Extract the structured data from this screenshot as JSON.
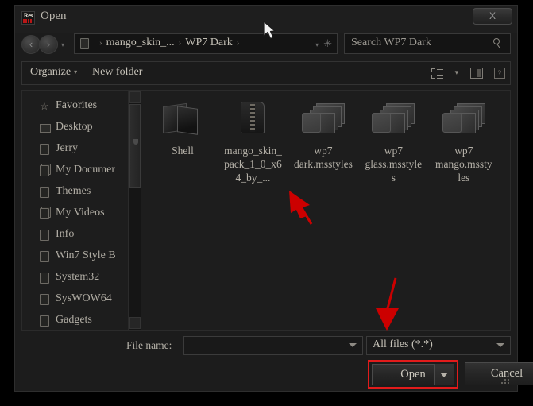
{
  "window": {
    "title": "Open",
    "app_icon": "resource-hacker-icon",
    "icon_text": "Res",
    "close_label": "X"
  },
  "addressbar": {
    "back_glyph": "‹",
    "forward_glyph": "›",
    "history_caret": "▾",
    "crumbs": [
      "mango_skin_...",
      "WP7 Dark"
    ],
    "separator": "›",
    "trailing_caret": "▾",
    "refresh_glyph": "✳",
    "search_placeholder": "Search WP7 Dark"
  },
  "toolbar": {
    "organize_label": "Organize",
    "organize_caret": "▾",
    "new_folder_label": "New folder",
    "view_caret": "▾",
    "help_glyph": "?"
  },
  "sidebar": {
    "items": [
      {
        "label": "Favorites",
        "icon": "star-icon"
      },
      {
        "label": "Desktop",
        "icon": "desktop-icon"
      },
      {
        "label": "Jerry",
        "icon": "folder-icon"
      },
      {
        "label": "My Documer",
        "icon": "documents-icon"
      },
      {
        "label": "Themes",
        "icon": "folder-icon"
      },
      {
        "label": "My Videos",
        "icon": "documents-icon"
      },
      {
        "label": "Info",
        "icon": "folder-icon"
      },
      {
        "label": "Win7 Style B",
        "icon": "folder-icon"
      },
      {
        "label": "System32",
        "icon": "folder-icon"
      },
      {
        "label": "SysWOW64",
        "icon": "folder-icon"
      },
      {
        "label": "Gadgets",
        "icon": "folder-icon"
      }
    ]
  },
  "files": {
    "items": [
      {
        "name": "Shell",
        "icon": "open-folder-icon"
      },
      {
        "name": "mango_skin_pack_1_0_x64_by_...",
        "icon": "zip-archive-icon"
      },
      {
        "name": "wp7 dark.msstyles",
        "icon": "msstyles-icon"
      },
      {
        "name": "wp7 glass.msstyles",
        "icon": "msstyles-icon"
      },
      {
        "name": "wp7 mango.msstyles",
        "icon": "msstyles-icon"
      }
    ]
  },
  "bottom": {
    "filename_label": "File name:",
    "filename_value": "",
    "filetype_value": "All files (*.*)",
    "open_label": "Open",
    "cancel_label": "Cancel"
  },
  "annotations": {
    "arrow_color": "#cc0000",
    "arrow_file_target": "wp7 dark.msstyles",
    "arrow_type_target": "All files (*.*)"
  }
}
